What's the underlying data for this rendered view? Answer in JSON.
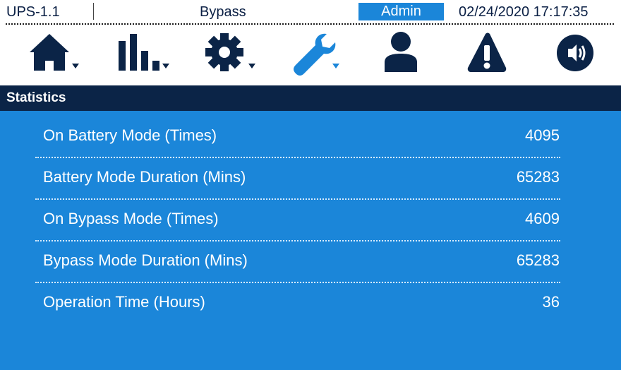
{
  "status_bar": {
    "device": "UPS-1.1",
    "mode": "Bypass",
    "user": "Admin",
    "datetime": "02/24/2020  17:17:35"
  },
  "nav_icons": [
    {
      "name": "home-icon",
      "has_dropdown": true,
      "color": "#0b2447"
    },
    {
      "name": "bar-chart-icon",
      "has_dropdown": true,
      "color": "#0b2447"
    },
    {
      "name": "gear-icon",
      "has_dropdown": true,
      "color": "#0b2447"
    },
    {
      "name": "wrench-icon",
      "has_dropdown": true,
      "color": "#1b86d9",
      "active": true
    },
    {
      "name": "user-icon",
      "has_dropdown": false,
      "color": "#0b2447"
    },
    {
      "name": "warning-icon",
      "has_dropdown": false,
      "color": "#0b2447"
    },
    {
      "name": "speaker-icon",
      "has_dropdown": false,
      "color": "#0b2447"
    }
  ],
  "section": {
    "title": "Statistics"
  },
  "stats": [
    {
      "label": "On Battery Mode (Times)",
      "value": "4095"
    },
    {
      "label": "Battery Mode Duration (Mins)",
      "value": "65283"
    },
    {
      "label": "On Bypass Mode (Times)",
      "value": "4609"
    },
    {
      "label": "Bypass Mode Duration (Mins)",
      "value": "65283"
    },
    {
      "label": "Operation Time (Hours)",
      "value": "36"
    }
  ],
  "colors": {
    "accent": "#1b86d9",
    "dark": "#0b2447",
    "panel": "#1b86d9"
  }
}
